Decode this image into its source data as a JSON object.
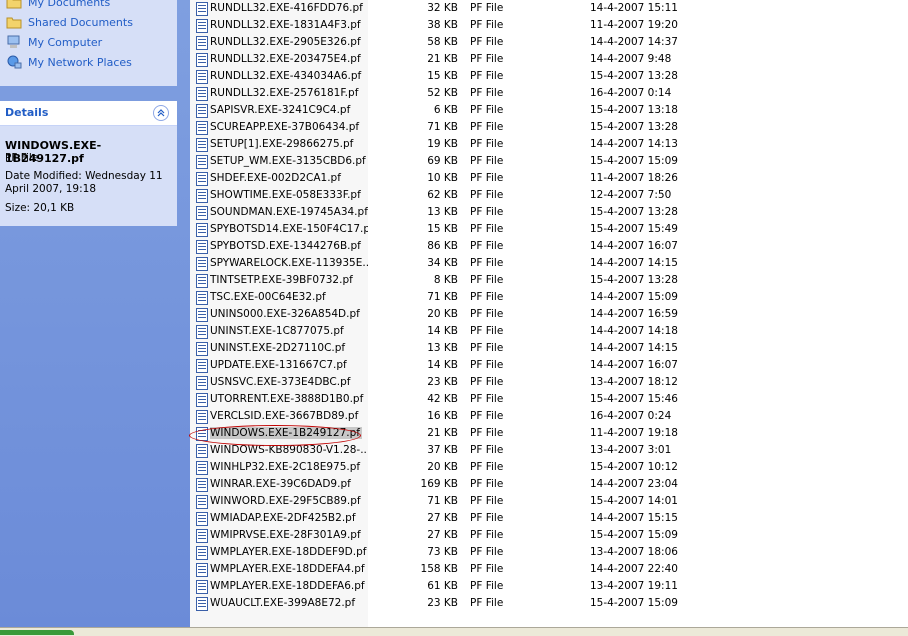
{
  "sidebar": {
    "places": [
      {
        "label": "My Documents",
        "icon": "folder-documents-icon"
      },
      {
        "label": "Shared Documents",
        "icon": "folder-shared-icon"
      },
      {
        "label": "My Computer",
        "icon": "computer-icon"
      },
      {
        "label": "My Network Places",
        "icon": "network-places-icon"
      }
    ],
    "details": {
      "title": "Details",
      "file_name": "WINDOWS.EXE-1B249127.pf",
      "file_type": "PF File",
      "modified_line1": "Date Modified: Wednesday 11",
      "modified_line2": "April 2007, 19:18",
      "size": "Size: 20,1 KB"
    }
  },
  "files": [
    {
      "name": "RUNDLL32.EXE-416FDD76.pf",
      "size": "32 KB",
      "type": "PF File",
      "date": "14-4-2007 15:11"
    },
    {
      "name": "RUNDLL32.EXE-1831A4F3.pf",
      "size": "38 KB",
      "type": "PF File",
      "date": "11-4-2007 19:20"
    },
    {
      "name": "RUNDLL32.EXE-2905E326.pf",
      "size": "58 KB",
      "type": "PF File",
      "date": "14-4-2007 14:37"
    },
    {
      "name": "RUNDLL32.EXE-203475E4.pf",
      "size": "21 KB",
      "type": "PF File",
      "date": "14-4-2007 9:48"
    },
    {
      "name": "RUNDLL32.EXE-434034A6.pf",
      "size": "15 KB",
      "type": "PF File",
      "date": "15-4-2007 13:28"
    },
    {
      "name": "RUNDLL32.EXE-2576181F.pf",
      "size": "52 KB",
      "type": "PF File",
      "date": "16-4-2007 0:14"
    },
    {
      "name": "SAPISVR.EXE-3241C9C4.pf",
      "size": "6 KB",
      "type": "PF File",
      "date": "15-4-2007 13:18"
    },
    {
      "name": "SCUREAPP.EXE-37B06434.pf",
      "size": "71 KB",
      "type": "PF File",
      "date": "15-4-2007 13:28"
    },
    {
      "name": "SETUP[1].EXE-29866275.pf",
      "size": "19 KB",
      "type": "PF File",
      "date": "14-4-2007 14:13"
    },
    {
      "name": "SETUP_WM.EXE-3135CBD6.pf",
      "size": "69 KB",
      "type": "PF File",
      "date": "15-4-2007 15:09"
    },
    {
      "name": "SHDEF.EXE-002D2CA1.pf",
      "size": "10 KB",
      "type": "PF File",
      "date": "11-4-2007 18:26"
    },
    {
      "name": "SHOWTIME.EXE-058E333F.pf",
      "size": "62 KB",
      "type": "PF File",
      "date": "12-4-2007 7:50"
    },
    {
      "name": "SOUNDMAN.EXE-19745A34.pf",
      "size": "13 KB",
      "type": "PF File",
      "date": "15-4-2007 13:28"
    },
    {
      "name": "SPYBOTSD14.EXE-150F4C17.pf",
      "size": "15 KB",
      "type": "PF File",
      "date": "15-4-2007 15:49"
    },
    {
      "name": "SPYBOTSD.EXE-1344276B.pf",
      "size": "86 KB",
      "type": "PF File",
      "date": "14-4-2007 16:07"
    },
    {
      "name": "SPYWARELOCK.EXE-113935E...",
      "size": "34 KB",
      "type": "PF File",
      "date": "14-4-2007 14:15"
    },
    {
      "name": "TINTSETP.EXE-39BF0732.pf",
      "size": "8 KB",
      "type": "PF File",
      "date": "15-4-2007 13:28"
    },
    {
      "name": "TSC.EXE-00C64E32.pf",
      "size": "71 KB",
      "type": "PF File",
      "date": "14-4-2007 15:09"
    },
    {
      "name": "UNINS000.EXE-326A854D.pf",
      "size": "20 KB",
      "type": "PF File",
      "date": "14-4-2007 16:59"
    },
    {
      "name": "UNINST.EXE-1C877075.pf",
      "size": "14 KB",
      "type": "PF File",
      "date": "14-4-2007 14:18"
    },
    {
      "name": "UNINST.EXE-2D27110C.pf",
      "size": "13 KB",
      "type": "PF File",
      "date": "14-4-2007 14:15"
    },
    {
      "name": "UPDATE.EXE-131667C7.pf",
      "size": "14 KB",
      "type": "PF File",
      "date": "14-4-2007 16:07"
    },
    {
      "name": "USNSVC.EXE-373E4DBC.pf",
      "size": "23 KB",
      "type": "PF File",
      "date": "13-4-2007 18:12"
    },
    {
      "name": "UTORRENT.EXE-3888D1B0.pf",
      "size": "42 KB",
      "type": "PF File",
      "date": "15-4-2007 15:46"
    },
    {
      "name": "VERCLSID.EXE-3667BD89.pf",
      "size": "16 KB",
      "type": "PF File",
      "date": "16-4-2007 0:24"
    },
    {
      "name": "WINDOWS.EXE-1B249127.pf",
      "size": "21 KB",
      "type": "PF File",
      "date": "11-4-2007 19:18",
      "selected": true
    },
    {
      "name": "WINDOWS-KB890830-V1.28-...",
      "size": "37 KB",
      "type": "PF File",
      "date": "13-4-2007 3:01"
    },
    {
      "name": "WINHLP32.EXE-2C18E975.pf",
      "size": "20 KB",
      "type": "PF File",
      "date": "15-4-2007 10:12"
    },
    {
      "name": "WINRAR.EXE-39C6DAD9.pf",
      "size": "169 KB",
      "type": "PF File",
      "date": "14-4-2007 23:04"
    },
    {
      "name": "WINWORD.EXE-29F5CB89.pf",
      "size": "71 KB",
      "type": "PF File",
      "date": "15-4-2007 14:01"
    },
    {
      "name": "WMIADAP.EXE-2DF425B2.pf",
      "size": "27 KB",
      "type": "PF File",
      "date": "14-4-2007 15:15"
    },
    {
      "name": "WMIPRVSE.EXE-28F301A9.pf",
      "size": "27 KB",
      "type": "PF File",
      "date": "15-4-2007 15:09"
    },
    {
      "name": "WMPLAYER.EXE-18DDEF9D.pf",
      "size": "73 KB",
      "type": "PF File",
      "date": "13-4-2007 18:06"
    },
    {
      "name": "WMPLAYER.EXE-18DDEFA4.pf",
      "size": "158 KB",
      "type": "PF File",
      "date": "14-4-2007 22:40"
    },
    {
      "name": "WMPLAYER.EXE-18DDEFA6.pf",
      "size": "61 KB",
      "type": "PF File",
      "date": "13-4-2007 19:11"
    },
    {
      "name": "WUAUCLT.EXE-399A8E72.pf",
      "size": "23 KB",
      "type": "PF File",
      "date": "15-4-2007 15:09"
    }
  ],
  "colors": {
    "link": "#215dc6",
    "sidebar_bg": "#6b8bd8",
    "panel_bg": "#d6dff7",
    "annotation": "#c00000"
  }
}
